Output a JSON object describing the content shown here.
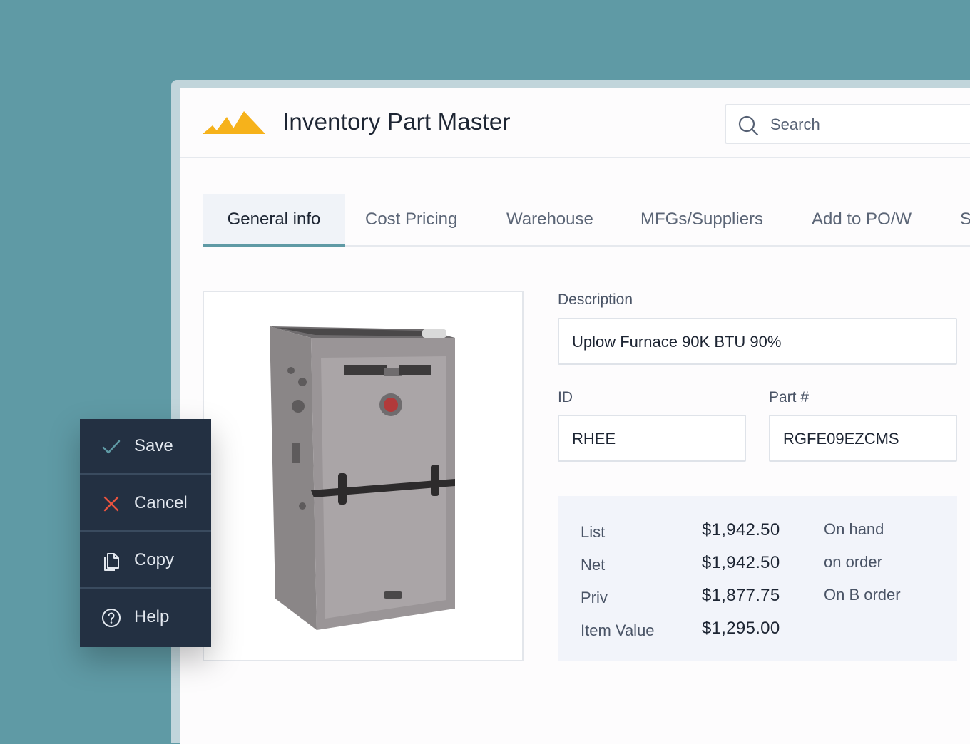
{
  "app": {
    "title": "Inventory Part Master",
    "logo": "mountain-logo",
    "accent_color": "#5f9aa5",
    "logo_color": "#f6b21b"
  },
  "search": {
    "placeholder": "Search",
    "icon": "search-icon"
  },
  "tabs": [
    {
      "label": "General info",
      "active": true
    },
    {
      "label": "Cost Pricing",
      "active": false
    },
    {
      "label": "Warehouse",
      "active": false
    },
    {
      "label": "MFGs/Suppliers",
      "active": false
    },
    {
      "label": "Add to PO/W",
      "active": false
    },
    {
      "label": "S",
      "active": false
    }
  ],
  "part": {
    "image": "furnace-product-image",
    "description_label": "Description",
    "description": "Uplow Furnace 90K BTU 90%",
    "id_label": "ID",
    "id": "RHEE",
    "part_label": "Part #",
    "part_number": "RGFE09EZCMS"
  },
  "pricing": {
    "rows": [
      {
        "label": "List",
        "value": "$1,942.50"
      },
      {
        "label": "Net",
        "value": "$1,942.50"
      },
      {
        "label": "Priv",
        "value": "$1,877.75"
      },
      {
        "label": "Item Value",
        "value": "$1,295.00"
      }
    ],
    "stock": [
      {
        "label": "On hand"
      },
      {
        "label": "on order"
      },
      {
        "label": "On B order"
      }
    ]
  },
  "actions": [
    {
      "label": "Save",
      "icon": "check-icon",
      "color": "#5f9aa5"
    },
    {
      "label": "Cancel",
      "icon": "close-icon",
      "color": "#e8533f"
    },
    {
      "label": "Copy",
      "icon": "copy-icon",
      "color": "#e3e8ef"
    },
    {
      "label": "Help",
      "icon": "help-icon",
      "color": "#e3e8ef"
    }
  ]
}
